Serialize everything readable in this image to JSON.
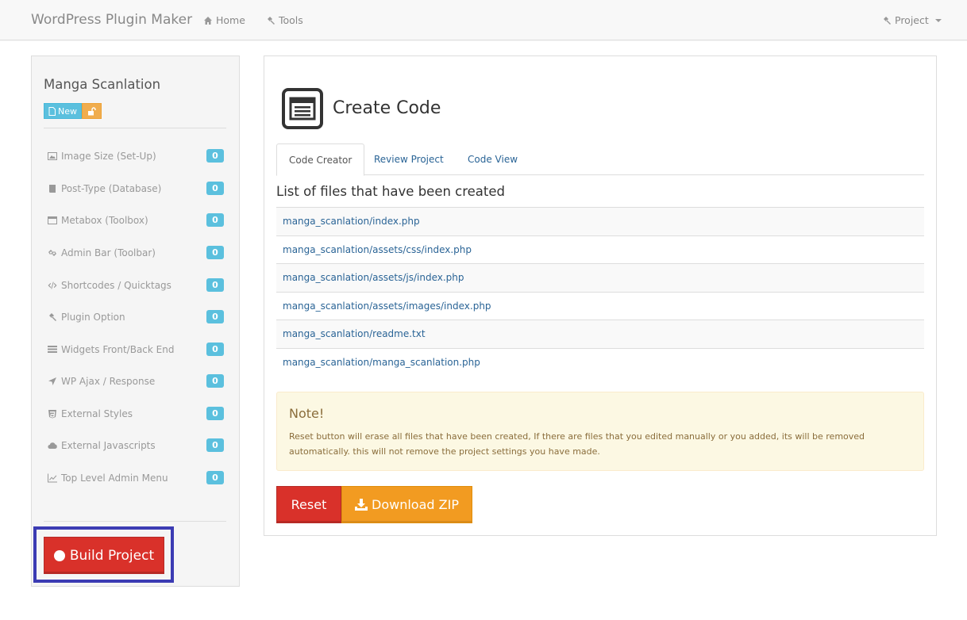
{
  "navbar": {
    "brand": "WordPress Plugin Maker",
    "home": "Home",
    "tools": "Tools",
    "project": "Project"
  },
  "sidebar": {
    "project_name": "Manga Scanlation",
    "new_label": "New",
    "items": [
      {
        "label": "Image Size (Set-Up)",
        "count": "0",
        "icon": "image-icon"
      },
      {
        "label": "Post-Type (Database)",
        "count": "0",
        "icon": "book-icon"
      },
      {
        "label": "Metabox (Toolbox)",
        "count": "0",
        "icon": "window-icon"
      },
      {
        "label": "Admin Bar (Toolbar)",
        "count": "0",
        "icon": "link-icon"
      },
      {
        "label": "Shortcodes / Quicktags",
        "count": "0",
        "icon": "code-icon"
      },
      {
        "label": "Plugin Option",
        "count": "0",
        "icon": "gavel-icon"
      },
      {
        "label": "Widgets Front/Back End",
        "count": "0",
        "icon": "list-icon"
      },
      {
        "label": "WP Ajax / Response",
        "count": "0",
        "icon": "arrow-icon"
      },
      {
        "label": "External Styles",
        "count": "0",
        "icon": "css3-icon"
      },
      {
        "label": "External Javascripts",
        "count": "0",
        "icon": "cloud-icon"
      },
      {
        "label": "Top Level Admin Menu",
        "count": "0",
        "icon": "chart-icon"
      }
    ],
    "build_label": "Build Project"
  },
  "main": {
    "title": "Create Code",
    "tabs": [
      "Code Creator",
      "Review Project",
      "Code View"
    ],
    "list_heading": "List of files that have been created",
    "files": [
      "manga_scanlation/index.php",
      "manga_scanlation/assets/css/index.php",
      "manga_scanlation/assets/js/index.php",
      "manga_scanlation/assets/images/index.php",
      "manga_scanlation/readme.txt",
      "manga_scanlation/manga_scanlation.php"
    ],
    "note_title": "Note!",
    "note_text": "Reset button will erase all files that have been created, If there are files that you edited manually or you added, its will be removed automatically. this will not remove the project settings you have made.",
    "reset_label": "Reset",
    "download_label": "Download ZIP"
  }
}
